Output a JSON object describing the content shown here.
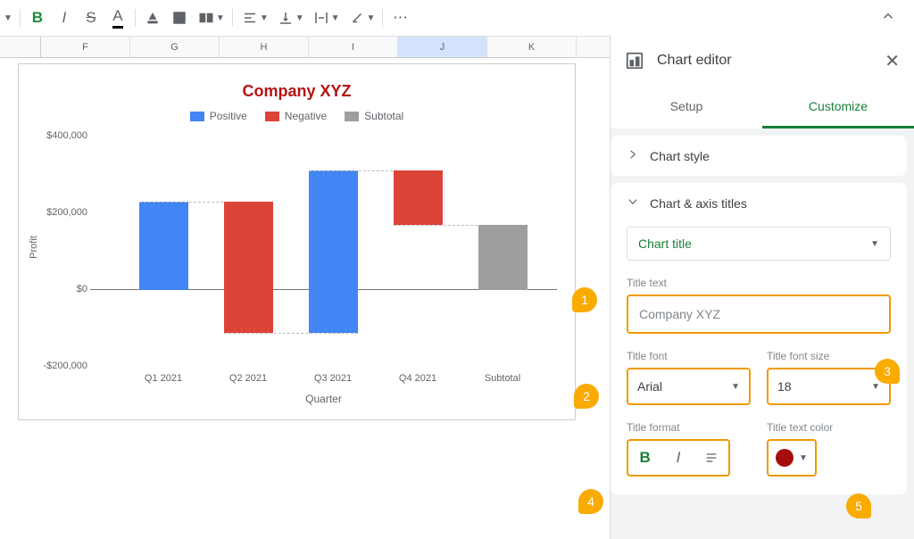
{
  "toolbar": {
    "bold": "B",
    "italic": "I",
    "strike": "S",
    "underline_letter": "A",
    "more": "⋯"
  },
  "col_headers": [
    "F",
    "G",
    "H",
    "I",
    "J",
    "K"
  ],
  "chart": {
    "title": "Company XYZ",
    "legend": {
      "pos": "Positive",
      "neg": "Negative",
      "sub": "Subtotal"
    },
    "ylabel": "Profit",
    "xlabel": "Quarter",
    "yticks": {
      "t0": "-$200,000",
      "t1": "$0",
      "t2": "$200,000",
      "t3": "$400,000"
    }
  },
  "chart_data": {
    "type": "bar",
    "subtype": "waterfall",
    "title": "Company XYZ",
    "xlabel": "Quarter",
    "ylabel": "Profit",
    "ylim": [
      -200000,
      400000
    ],
    "categories": [
      "Q1 2021",
      "Q2 2021",
      "Q3 2021",
      "Q4 2021",
      "Subtotal"
    ],
    "series": [
      {
        "name": "Positive",
        "color": "#4285f4",
        "values": [
          230000,
          null,
          420000,
          null,
          null
        ]
      },
      {
        "name": "Negative",
        "color": "#db4437",
        "values": [
          null,
          -340000,
          null,
          -140000,
          null
        ]
      },
      {
        "name": "Subtotal",
        "color": "#9e9e9e",
        "values": [
          null,
          null,
          null,
          null,
          170000
        ]
      }
    ],
    "cumulative": [
      230000,
      -110000,
      310000,
      170000,
      170000
    ],
    "y_ticks": [
      -200000,
      0,
      200000,
      400000
    ]
  },
  "xcats": {
    "c0": "Q1 2021",
    "c1": "Q2 2021",
    "c2": "Q3 2021",
    "c3": "Q4 2021",
    "c4": "Subtotal"
  },
  "sidebar": {
    "title": "Chart editor",
    "tabs": {
      "setup": "Setup",
      "customize": "Customize"
    },
    "sections": {
      "style": "Chart style",
      "titles": "Chart & axis titles"
    },
    "title_selector": "Chart title",
    "labels": {
      "title_text": "Title text",
      "title_font": "Title font",
      "title_size": "Title font size",
      "title_format": "Title format",
      "title_color": "Title text color"
    },
    "values": {
      "title_text": "Company XYZ",
      "font": "Arial",
      "size": "18"
    }
  },
  "annotations": {
    "a1": "1",
    "a2": "2",
    "a3": "3",
    "a4": "4",
    "a5": "5"
  }
}
